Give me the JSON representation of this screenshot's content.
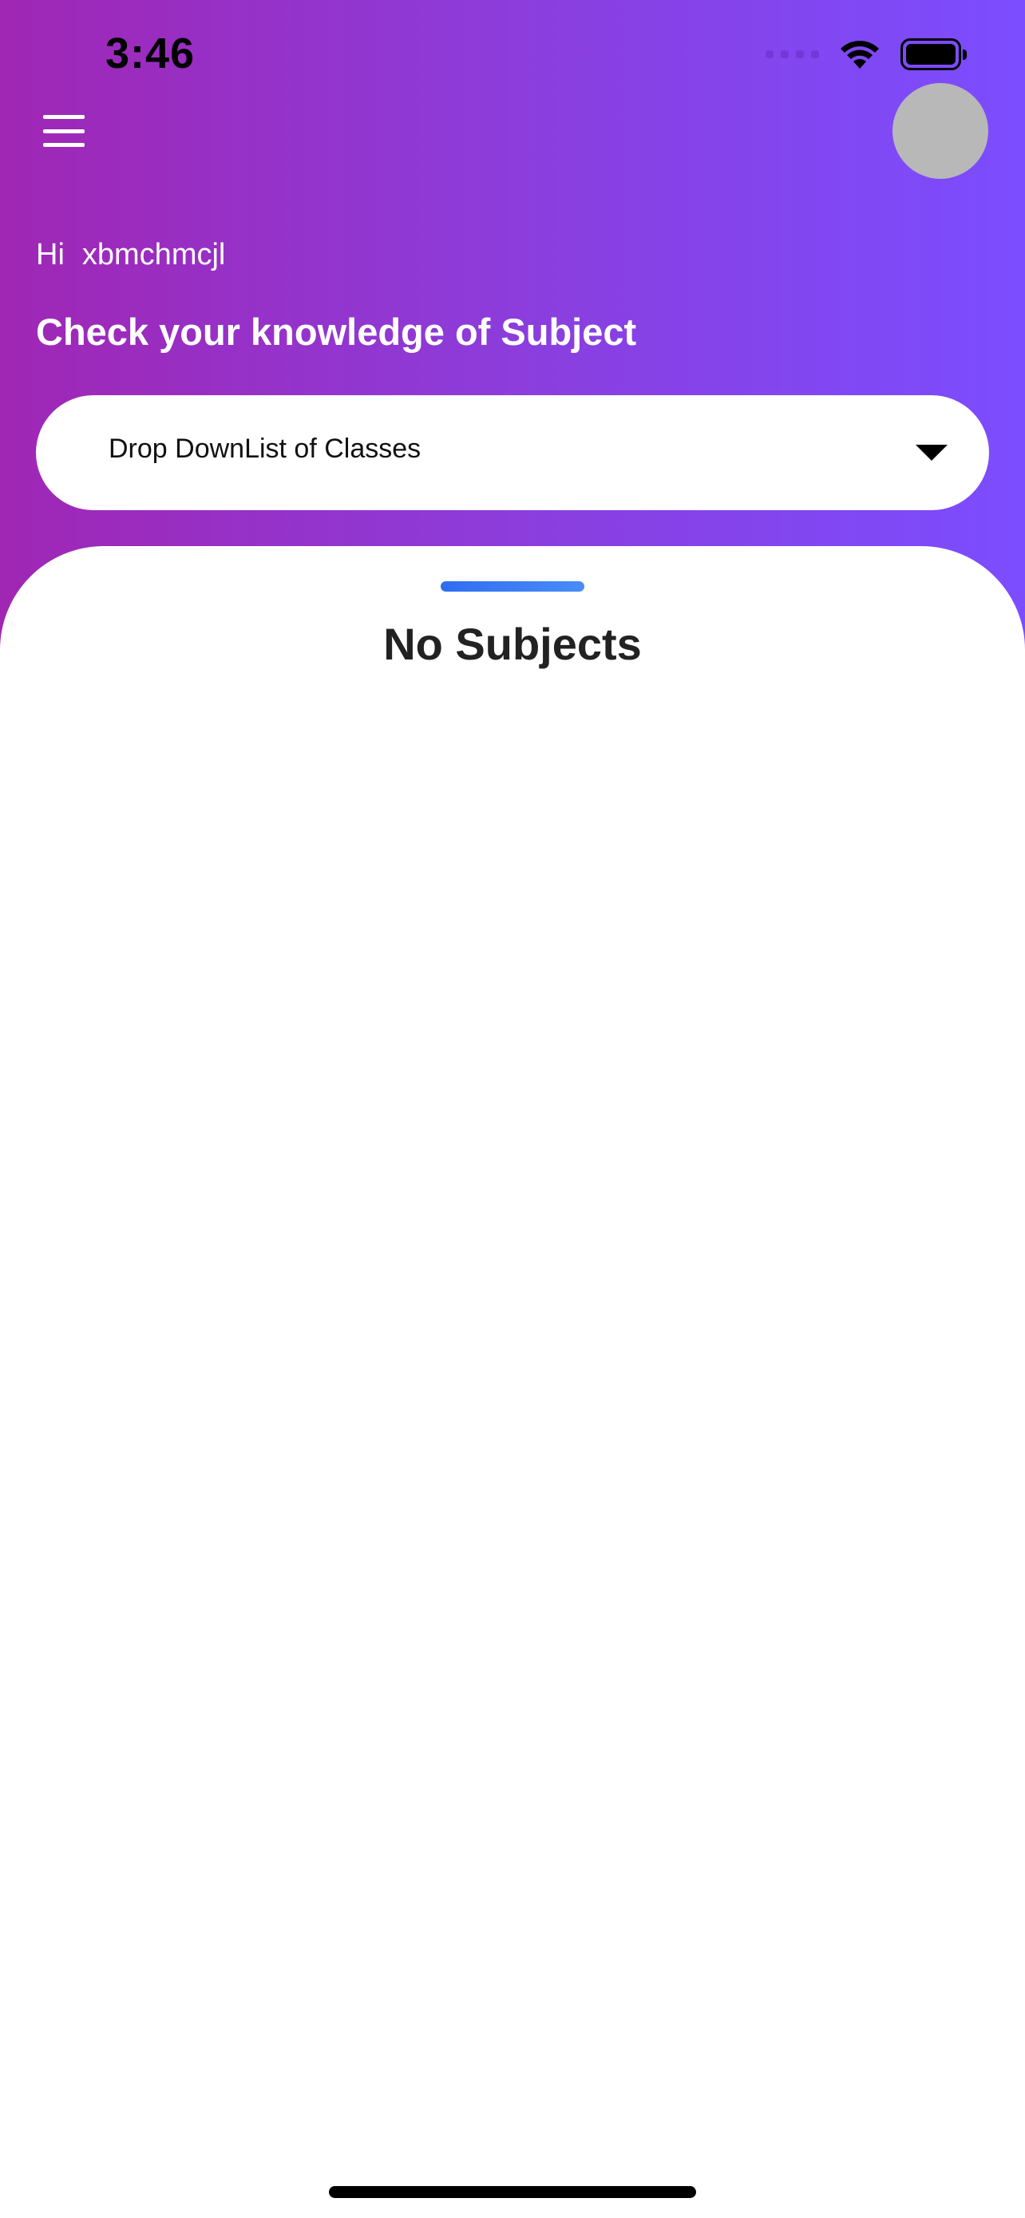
{
  "status_bar": {
    "time": "3:46"
  },
  "colors": {
    "header_gradient_start": "#a026b4",
    "header_gradient_end": "#7b4dff",
    "avatar": "#b8b8b8",
    "sheet_handle": "#3b7cf3"
  },
  "icons": {
    "menu": "hamburger-menu-icon",
    "signal": "cellular-signal-icon",
    "wifi": "wifi-icon",
    "battery": "battery-icon",
    "caret": "caret-down-icon"
  },
  "greeting": {
    "hi": "Hi",
    "user_name": "xbmchmcjl"
  },
  "headline": "Check your knowledge of Subject",
  "class_dropdown": {
    "selected_label": "Drop DownList of Classes"
  },
  "subjects": {
    "empty_message": "No Subjects"
  }
}
